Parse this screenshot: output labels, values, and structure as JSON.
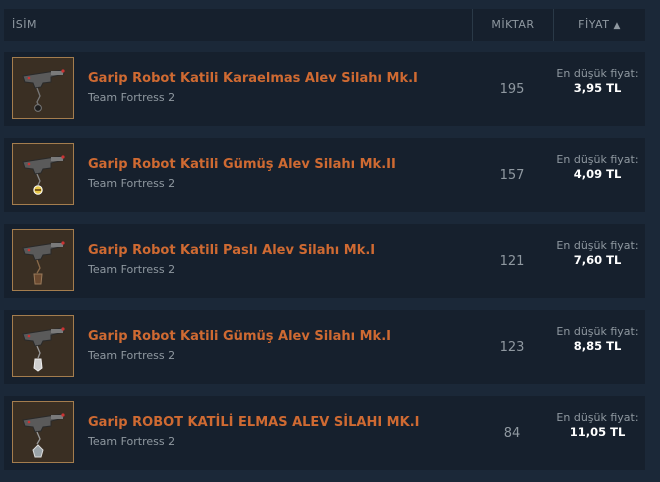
{
  "header": {
    "name": "İSİM",
    "quantity": "MİKTAR",
    "price": "FİYAT",
    "sort_arrow": "▲"
  },
  "rows": [
    {
      "name": "Garip Robot Katili Karaelmas Alev Silahı Mk.I",
      "game": "Team Fortress 2",
      "quantity": "195",
      "price_label": "En düşük fiyat:",
      "price": "3,95 TL",
      "icon": "flamethrower-icon"
    },
    {
      "name": "Garip Robot Katili Gümüş Alev Silahı Mk.II",
      "game": "Team Fortress 2",
      "quantity": "157",
      "price_label": "En düşük fiyat:",
      "price": "4,09 TL",
      "icon": "flamethrower-icon"
    },
    {
      "name": "Garip Robot Katili Paslı Alev Silahı Mk.I",
      "game": "Team Fortress 2",
      "quantity": "121",
      "price_label": "En düşük fiyat:",
      "price": "7,60 TL",
      "icon": "flamethrower-icon"
    },
    {
      "name": "Garip Robot Katili Gümüş Alev Silahı Mk.I",
      "game": "Team Fortress 2",
      "quantity": "123",
      "price_label": "En düşük fiyat:",
      "price": "8,85 TL",
      "icon": "flamethrower-icon"
    },
    {
      "name": "Garip ROBOT KATİLİ ELMAS ALEV SİLAHI MK.I",
      "game": "Team Fortress 2",
      "quantity": "84",
      "price_label": "En düşük fiyat:",
      "price": "11,05 TL",
      "icon": "flamethrower-icon"
    }
  ],
  "colors": {
    "background": "#1b2838",
    "row_background": "#16202d",
    "item_name_strange": "#cf6a32",
    "thumbnail_border": "#a47d4e",
    "muted_text": "#8f98a0",
    "price_text": "#ffffff"
  }
}
